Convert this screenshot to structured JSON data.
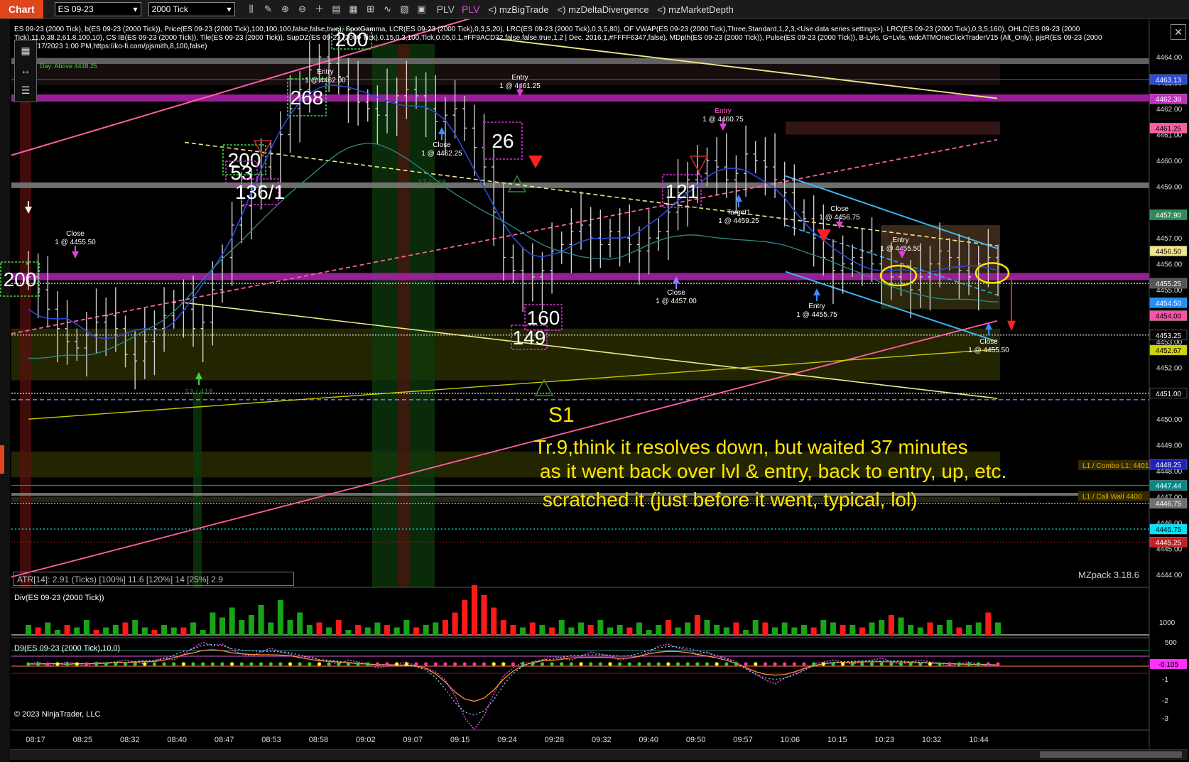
{
  "toolbar": {
    "tab_label": "Chart",
    "instrument": "ES 09-23",
    "interval": "2000 Tick",
    "plv_1": "PLV",
    "plv_2": "PLV",
    "indicators": [
      "<) mzBigTrade",
      "<) mzDeltaDivergence",
      "<) mzMarketDepth"
    ]
  },
  "info_text": "ES 09-23 (2000 Tick), b(ES 09-23 (2000 Tick)), Price(ES 09-23 (2000 Tick),100,100,100,false,false,true), SpotGamma, LCR(ES 09-23 (2000 Tick),0,3,5,20), LRC(ES 09-23 (2000 Tick),0,3,5,80), OF VWAP(ES 09-23 (2000 Tick),Three,Standard,1,2,3,<Use data series settings>), LRC(ES 09-23 (2000 Tick),0,3,5,160), OHLC(ES 09-23 (2000 Tick),11,0,38.2,61.8,100,10), CS IB(ES 09-23 (2000 Tick)), Tile(ES 09-23 (2000 Tick)), SupDZ(ES 09-23 (2000 Tick),0.15,0.3,100,Tick,0.05,0.1,#FF9ACD32,false,false,true,1,2 | Dec. 2016,1,#FFFF6347,false), MDpth(ES 09-23 (2000 Tick)), Pulse(ES 09-23 (2000 Tick)), B-Lvls, G=Lvls, wdcATMOneClickTraderV15 (Alt_Only), pjsR(ES 09-23 (2000 Tick),6/17/2023 1:00 PM,https://ko-fi.com/pjsmith,8,100,false)",
  "day_label": "Day: Above 4448.25",
  "atr_text": "ATR[14]: 2.91 (Ticks) [100%] 11.6  [120%] 14  [25%] 2.9",
  "version_text": "MZpack 3.18.6",
  "div_panel_title": "Div(ES 09-23 (2000 Tick))",
  "d9_panel_title": "D9(ES 09-23 (2000 Tick),10,0)",
  "copyright": "© 2023 NinjaTrader, LLC",
  "annotation": {
    "s1": "S1",
    "line1": "Tr.9,think it resolves down, but waited 37 minutes",
    "line2": "as it went back over lvl & entry, back to entry, up, etc.",
    "line3": "scratched it (just before it went, typical, lol)"
  },
  "level_labels": [
    "L1 / Combo L1: 4401",
    "L1 / Call Wall 4400"
  ],
  "icons": [
    "chevron-down-icon",
    "pencil-icon",
    "zoom-in-icon",
    "zoom-out-icon",
    "crosshair-icon",
    "properties-icon",
    "bar-type-icon",
    "indicator-icon",
    "strategy-icon",
    "data-box-icon",
    "close-icon"
  ],
  "chart_data": {
    "type": "candlestick",
    "instrument": "ES 09-23 (2000 Tick)",
    "ylim": [
      4443.5,
      4464.5
    ],
    "y_ticks": [
      4444,
      4445,
      4446,
      4447,
      4448,
      4449,
      4450,
      4451,
      4452,
      4453,
      4454,
      4455,
      4456,
      4457,
      4458,
      4459,
      4460,
      4461,
      4462,
      4463,
      4464
    ],
    "x_labels": [
      "08:17",
      "08:25",
      "08:32",
      "08:40",
      "08:47",
      "08:53",
      "08:58",
      "09:02",
      "09:07",
      "09:15",
      "09:24",
      "09:28",
      "09:32",
      "09:40",
      "09:50",
      "09:57",
      "10:06",
      "10:15",
      "10:23",
      "10:32",
      "10:44"
    ],
    "price_markers": [
      {
        "label": "4463.13",
        "value": 4463.13,
        "color": "#2a4bd7"
      },
      {
        "label": "4462.38",
        "value": 4462.38,
        "color": "#c030c0"
      },
      {
        "label": "4461.25",
        "value": 4461.25,
        "color": "#ff5fa2"
      },
      {
        "label": "4457.90",
        "value": 4457.9,
        "color": "#2e8b57"
      },
      {
        "label": "4456.50",
        "value": 4456.5,
        "color": "#f0e68c"
      },
      {
        "label": "4455.25",
        "value": 4455.25,
        "color": "#555555"
      },
      {
        "label": "4454.50",
        "value": 4454.5,
        "color": "#1e90ff"
      },
      {
        "label": "4454.00",
        "value": 4454.0,
        "color": "#ff4fa8"
      },
      {
        "label": "4453.25",
        "value": 4453.25,
        "color": "#000000"
      },
      {
        "label": "4452.67",
        "value": 4452.67,
        "color": "#d4d400"
      },
      {
        "label": "4451.00",
        "value": 4451.0,
        "color": "#000000"
      },
      {
        "label": "4448.25",
        "value": 4448.25,
        "color": "#2020c0"
      },
      {
        "label": "4447.44",
        "value": 4447.44,
        "color": "#008b8b"
      },
      {
        "label": "4446.75",
        "value": 4446.75,
        "color": "#707070"
      },
      {
        "label": "4445.75",
        "value": 4445.75,
        "color": "#00e5ff"
      },
      {
        "label": "4445.25",
        "value": 4445.25,
        "color": "#c02020"
      }
    ],
    "closes": [
      4455.5,
      4455.0,
      4454.25,
      4453.5,
      4453.0,
      4452.75,
      4453.25,
      4453.75,
      4454.0,
      4453.5,
      4452.5,
      4452.25,
      4453.0,
      4453.5,
      4454.0,
      4454.5,
      4454.25,
      4453.5,
      4453.75,
      4455.0,
      4456.25,
      4457.5,
      4458.25,
      4459.0,
      4459.75,
      4460.25,
      4461.0,
      4462.0,
      4462.75,
      4463.5,
      4464.0,
      4463.75,
      4463.25,
      4462.75,
      4462.25,
      4462.0,
      4461.75,
      4462.25,
      4462.5,
      4462.75,
      4462.5,
      4462.0,
      4461.5,
      4461.75,
      4462.0,
      4461.25,
      4460.5,
      4459.75,
      4458.0,
      4456.25,
      4455.75,
      4455.25,
      4455.5,
      4455.75,
      4456.5,
      4456.75,
      4457.25,
      4457.5,
      4457.0,
      4456.75,
      4457.25,
      4457.0,
      4456.75,
      4456.5,
      4457.0,
      4457.25,
      4458.0,
      4458.75,
      4459.25,
      4459.5,
      4460.0,
      4459.75,
      4459.25,
      4459.5,
      4460.25,
      4460.0,
      4459.75,
      4459.25,
      4458.75,
      4458.0,
      4457.75,
      4457.0,
      4456.25,
      4455.75,
      4456.0,
      4456.25,
      4456.5,
      4456.0,
      4455.75,
      4455.5,
      4455.25,
      4455.0,
      4455.5,
      4456.0,
      4456.5,
      4456.25,
      4455.75,
      4455.5,
      4456.0,
      4456.25,
      4455.25
    ],
    "div_values": [
      4,
      -3,
      5,
      2,
      -4,
      3,
      6,
      -2,
      3,
      4,
      -5,
      6,
      3,
      -2,
      4,
      3,
      -3,
      5,
      2,
      9,
      7,
      11,
      6,
      8,
      12,
      5,
      14,
      6,
      9,
      4,
      -5,
      3,
      -6,
      2,
      -4,
      3,
      5,
      -4,
      3,
      6,
      -3,
      4,
      5,
      -6,
      -9,
      -14,
      -20,
      -16,
      -11,
      -6,
      -4,
      3,
      -5,
      4,
      -3,
      6,
      3,
      5,
      -4,
      6,
      3,
      4,
      -3,
      5,
      2,
      4,
      -6,
      3,
      5,
      -8,
      6,
      4,
      3,
      -5,
      2,
      6,
      -5,
      3,
      5,
      3,
      4,
      -3,
      6,
      5,
      -4,
      4,
      -3,
      5,
      6,
      -8,
      7,
      4,
      3,
      -5,
      4,
      6,
      -3,
      4,
      5,
      -9,
      5
    ],
    "d9_values": [
      0.0,
      0.1,
      -0.1,
      0.0,
      0.1,
      0.0,
      -0.1,
      0.1,
      0.0,
      0.1,
      0.2,
      0.1,
      0.0,
      0.2,
      0.3,
      0.2,
      0.5,
      0.8,
      1.1,
      0.9,
      1.0,
      0.7,
      0.5,
      0.4,
      0.6,
      0.8,
      0.6,
      0.5,
      0.3,
      0.4,
      0.2,
      0.1,
      0.0,
      0.2,
      0.1,
      0.0,
      -0.2,
      -0.1,
      0.0,
      0.1,
      -0.1,
      -0.2,
      -0.4,
      -0.8,
      -1.6,
      -2.7,
      -3.3,
      -2.6,
      -1.5,
      -0.6,
      -0.2,
      0.1,
      0.0,
      0.2,
      0.4,
      0.3,
      0.2,
      0.4,
      0.6,
      0.5,
      0.4,
      0.2,
      0.3,
      0.4,
      0.6,
      0.9,
      1.0,
      0.8,
      0.7,
      0.5,
      0.6,
      0.4,
      0.3,
      0.1,
      -0.2,
      -0.5,
      -0.8,
      -1.0,
      -0.7,
      -0.5,
      -0.3,
      0.0,
      0.1,
      0.2,
      0.1,
      0.0,
      0.1,
      0.2,
      0.3,
      0.1,
      0.0,
      0.1,
      0.2,
      0.1,
      0.0,
      -0.1,
      0.0,
      0.1,
      0.0,
      -0.1,
      -0.1
    ],
    "div_ticks": [
      1000,
      500
    ],
    "d9_ticks": [
      -1,
      -2,
      -3
    ],
    "d9_current": "-0.105",
    "boxes": [
      {
        "label": "200",
        "value": 4455.5
      },
      {
        "label": "268",
        "value": 4462.0
      },
      {
        "label": "200",
        "value": 4459.5
      },
      {
        "label": "53",
        "value": 4459.0
      },
      {
        "label": "136/1",
        "value": 4458.5
      },
      {
        "label": "200",
        "value": 4464.0
      },
      {
        "label": "26",
        "value": 4460.5
      },
      {
        "label": "160",
        "value": 4453.5
      },
      {
        "label": "149",
        "value": 4452.75
      },
      {
        "label": "121",
        "value": 4458.5
      }
    ],
    "trades": [
      {
        "text1": "Close",
        "text2": "1 @ 4455.50"
      },
      {
        "text1": "Entry",
        "text2": "1 @ 4462.00"
      },
      {
        "text1": "Close",
        "text2": "1 @ 4462.25"
      },
      {
        "text1": "Entry",
        "text2": "1 @ 4461.25"
      },
      {
        "text1": "Entry",
        "text2": "1 @ 4460.75"
      },
      {
        "text1": "Target1",
        "text2": "1 @ 4459.25"
      },
      {
        "text1": "Close",
        "text2": "1 @ 4457.00"
      },
      {
        "text1": "Close",
        "text2": "1 @ 4456.75"
      },
      {
        "text1": "Entry",
        "text2": "1 @ 4455.75"
      },
      {
        "text1": "Entry",
        "text2": "1 @ 4455.50"
      },
      {
        "text1": "Close",
        "text2": "1 @ 4455.50"
      }
    ],
    "faint_labels": [
      "17 / 248",
      "13 / 418"
    ],
    "grid": false
  }
}
